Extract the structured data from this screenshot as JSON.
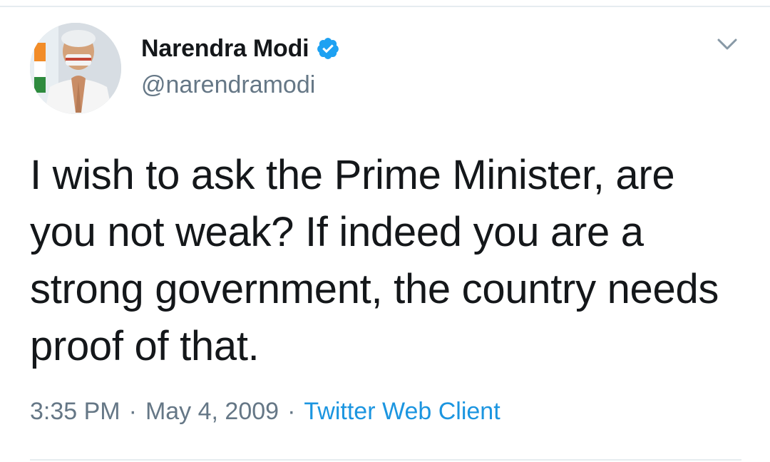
{
  "author": {
    "name": "Narendra Modi",
    "handle": "@narendramodi",
    "verified": true
  },
  "tweet": {
    "text": "I wish to ask the Prime Minister, are you not weak? If indeed you are a strong government, the country needs proof of that.",
    "time": "3:35 PM",
    "separator": "·",
    "date": "May 4, 2009",
    "source": "Twitter Web Client"
  },
  "icons": {
    "verified": "verified-badge-icon",
    "menu": "chevron-down-icon"
  },
  "colors": {
    "name_text": "#14171a",
    "secondary_text": "#657786",
    "link_blue": "#1b95e0",
    "verified_blue": "#1da1f2",
    "divider": "#e6ecf0"
  }
}
